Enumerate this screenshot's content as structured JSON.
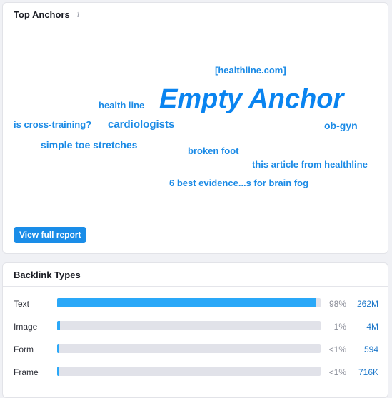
{
  "top_anchors": {
    "title": "Top Anchors",
    "info_icon": "info-icon",
    "words": [
      {
        "text": "[healthline.com]",
        "size": "small"
      },
      {
        "text": "Empty Anchor",
        "size": "largest"
      },
      {
        "text": "health line",
        "size": "small"
      },
      {
        "text": "is cross-training?",
        "size": "small"
      },
      {
        "text": "cardiologists",
        "size": "medium"
      },
      {
        "text": "ob-gyn",
        "size": "small"
      },
      {
        "text": "simple toe stretches",
        "size": "small"
      },
      {
        "text": "broken foot",
        "size": "small"
      },
      {
        "text": "this article from healthline",
        "size": "small"
      },
      {
        "text": "6 best evidence...s for brain fog",
        "size": "small"
      }
    ],
    "view_button": "View full report"
  },
  "backlink_types": {
    "title": "Backlink Types",
    "colors": {
      "fill": "#2aa8f8",
      "track": "#e1e2e9",
      "count": "#1a76c9"
    },
    "rows": [
      {
        "label": "Text",
        "percent_text": "98%",
        "fill_fraction": 0.98,
        "count": "262M"
      },
      {
        "label": "Image",
        "percent_text": "1%",
        "fill_fraction": 0.01,
        "count": "4M"
      },
      {
        "label": "Form",
        "percent_text": "<1%",
        "fill_fraction": 0.003,
        "count": "594"
      },
      {
        "label": "Frame",
        "percent_text": "<1%",
        "fill_fraction": 0.003,
        "count": "716K"
      }
    ]
  }
}
